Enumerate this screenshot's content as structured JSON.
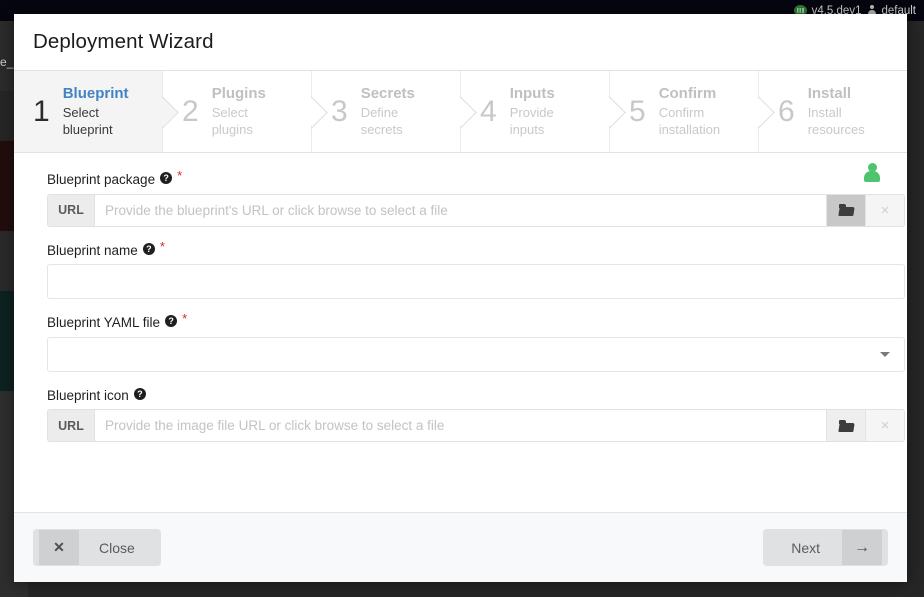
{
  "background": {
    "topbar": {
      "version_label": "v4.5.dev1",
      "tenant_label": "default",
      "signal_icon": "signal-icon",
      "person_icon": "person-icon"
    },
    "left_text_fragment": "e_"
  },
  "modal": {
    "title": "Deployment Wizard",
    "steps": [
      {
        "number": "1",
        "title": "Blueprint",
        "subtitle": "Select blueprint",
        "active": true
      },
      {
        "number": "2",
        "title": "Plugins",
        "subtitle": "Select plugins",
        "active": false
      },
      {
        "number": "3",
        "title": "Secrets",
        "subtitle": "Define secrets",
        "active": false
      },
      {
        "number": "4",
        "title": "Inputs",
        "subtitle": "Provide inputs",
        "active": false
      },
      {
        "number": "5",
        "title": "Confirm",
        "subtitle": "Confirm installation",
        "active": false
      },
      {
        "number": "6",
        "title": "Install",
        "subtitle": "Install resources",
        "active": false
      }
    ],
    "user_badge_icon": "user-icon",
    "fields": {
      "blueprint_package": {
        "label": "Blueprint package",
        "required_marker": "*",
        "help_icon": "help-icon",
        "url_prefix": "URL",
        "placeholder": "Provide the blueprint's URL or click browse to select a file",
        "value": "",
        "browse_icon": "folder-icon",
        "clear_icon": "×"
      },
      "blueprint_name": {
        "label": "Blueprint name",
        "required_marker": "*",
        "help_icon": "help-icon",
        "placeholder": "",
        "value": ""
      },
      "blueprint_yaml_file": {
        "label": "Blueprint YAML file",
        "required_marker": "*",
        "help_icon": "help-icon",
        "selected_option": "",
        "caret_icon": "chevron-down-icon"
      },
      "blueprint_icon": {
        "label": "Blueprint icon",
        "required_marker": "",
        "help_icon": "help-icon",
        "url_prefix": "URL",
        "placeholder": "Provide the image file URL or click browse to select a file",
        "value": "",
        "browse_icon": "folder-icon",
        "clear_icon": "×"
      }
    },
    "footer": {
      "close_label": "Close",
      "close_icon": "✕",
      "next_label": "Next",
      "next_icon": "→"
    }
  },
  "colors": {
    "accent_blue": "#4183c4",
    "required_red": "#db2828",
    "user_green": "#4fc46e",
    "modal_bg": "#ffffff",
    "active_step_bg": "#f4f4f4",
    "footer_bg": "#f8f9fa"
  }
}
